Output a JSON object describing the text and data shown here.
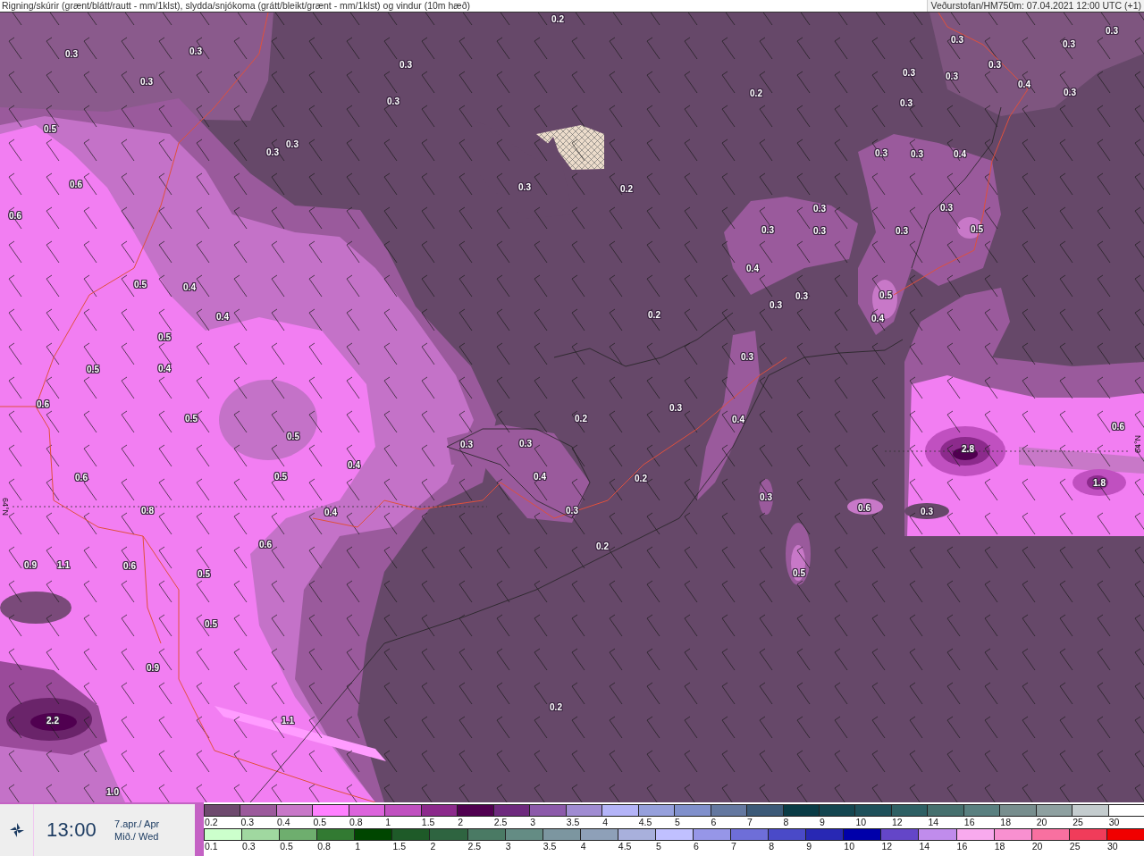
{
  "header": {
    "title": "Rigning/skúrir (grænt/blátt/rautt - mm/1klst), slydda/snjókoma (grátt/bleikt/grænt - mm/1klst) og vindur (10m hæð)",
    "source": "Veðurstofan/HM750m: 07.04.2021 12:00 UTC (+1)"
  },
  "map": {
    "labels": [
      {
        "text": "0.2"
      },
      {
        "text": "0.3"
      },
      {
        "text": "0.3"
      },
      {
        "text": "0.3"
      },
      {
        "text": "0.3"
      },
      {
        "text": "0.3"
      },
      {
        "text": "0.3"
      },
      {
        "text": "0.3"
      },
      {
        "text": "0.3"
      },
      {
        "text": "0.3"
      },
      {
        "text": "0.3"
      },
      {
        "text": "0.4"
      },
      {
        "text": "0.2"
      },
      {
        "text": "0.3"
      },
      {
        "text": "0.3"
      },
      {
        "text": "0.3"
      },
      {
        "text": "0.5"
      },
      {
        "text": "0.3"
      },
      {
        "text": "0.3"
      },
      {
        "text": "0.3"
      },
      {
        "text": "0.3"
      },
      {
        "text": "0.4"
      },
      {
        "text": "0.6"
      },
      {
        "text": "0.3"
      },
      {
        "text": "0.2"
      },
      {
        "text": "0.3"
      },
      {
        "text": "0.3"
      },
      {
        "text": "0.6"
      },
      {
        "text": "0.3"
      },
      {
        "text": "0.3"
      },
      {
        "text": "0.3"
      },
      {
        "text": "0.5"
      },
      {
        "text": "0.4"
      },
      {
        "text": "0.5"
      },
      {
        "text": "0.4"
      },
      {
        "text": "0.3"
      },
      {
        "text": "0.5"
      },
      {
        "text": "0.3"
      },
      {
        "text": "0.4"
      },
      {
        "text": "0.2"
      },
      {
        "text": "0.4"
      },
      {
        "text": "0.5"
      },
      {
        "text": "0.3"
      },
      {
        "text": "0.5"
      },
      {
        "text": "0.4"
      },
      {
        "text": "0.6"
      },
      {
        "text": "0.3"
      },
      {
        "text": "0.5"
      },
      {
        "text": "0.2"
      },
      {
        "text": "0.4"
      },
      {
        "text": "0.6"
      },
      {
        "text": "0.5"
      },
      {
        "text": "0.3"
      },
      {
        "text": "0.3"
      },
      {
        "text": "2.8"
      },
      {
        "text": "0.4"
      },
      {
        "text": "0.6"
      },
      {
        "text": "0.5"
      },
      {
        "text": "0.4"
      },
      {
        "text": "0.2"
      },
      {
        "text": "1.8"
      },
      {
        "text": "0.3"
      },
      {
        "text": "0.8"
      },
      {
        "text": "0.4"
      },
      {
        "text": "0.3"
      },
      {
        "text": "0.6"
      },
      {
        "text": "0.3"
      },
      {
        "text": "0.6"
      },
      {
        "text": "0.2"
      },
      {
        "text": "0.9"
      },
      {
        "text": "1.1"
      },
      {
        "text": "0.6"
      },
      {
        "text": "0.5"
      },
      {
        "text": "0.5"
      },
      {
        "text": "0.5"
      },
      {
        "text": "0.9"
      },
      {
        "text": "0.2"
      },
      {
        "text": "2.2"
      },
      {
        "text": "1.1"
      },
      {
        "text": "1.0"
      }
    ],
    "latitude_labels": [
      "64°N",
      "64°N"
    ]
  },
  "time_panel": {
    "time": "13:00",
    "date": "7.apr./ Apr",
    "weekday": "Mið./ Wed"
  },
  "legend": {
    "rows": [
      {
        "items": [
          {
            "label": "0.2",
            "color": "#6e4a6e"
          },
          {
            "label": "0.3",
            "color": "#9c5a9c"
          },
          {
            "label": "0.4",
            "color": "#c878c8"
          },
          {
            "label": "0.5",
            "color": "#ff80ff"
          },
          {
            "label": "0.8",
            "color": "#dc64dc"
          },
          {
            "label": "1",
            "color": "#c050c0"
          },
          {
            "label": "1.5",
            "color": "#8c2a8c"
          },
          {
            "label": "2",
            "color": "#500050"
          },
          {
            "label": "2.5",
            "color": "#6e2a7e"
          },
          {
            "label": "3",
            "color": "#8c5aaa"
          },
          {
            "label": "3.5",
            "color": "#a08cd2"
          },
          {
            "label": "4",
            "color": "#b4b4f8"
          },
          {
            "label": "4.5",
            "color": "#96a0dc"
          },
          {
            "label": "5",
            "color": "#8090cc"
          },
          {
            "label": "6",
            "color": "#6478a0"
          },
          {
            "label": "7",
            "color": "#3c5a78"
          },
          {
            "label": "8",
            "color": "#0a3c46"
          },
          {
            "label": "9",
            "color": "#144650"
          },
          {
            "label": "10",
            "color": "#1e505a"
          },
          {
            "label": "12",
            "color": "#2e6064"
          },
          {
            "label": "14",
            "color": "#46706e"
          },
          {
            "label": "16",
            "color": "#5a8080"
          },
          {
            "label": "18",
            "color": "#788e8e"
          },
          {
            "label": "20",
            "color": "#8ea0a0"
          },
          {
            "label": "25",
            "color": "#c4ccce"
          },
          {
            "label": "30",
            "color": "#ffffff"
          }
        ]
      },
      {
        "items": [
          {
            "label": "0.1",
            "color": "#ccffcc"
          },
          {
            "label": "0.3",
            "color": "#a0d8a0"
          },
          {
            "label": "0.5",
            "color": "#6eae6e"
          },
          {
            "label": "0.8",
            "color": "#327a32"
          },
          {
            "label": "1",
            "color": "#004600"
          },
          {
            "label": "1.5",
            "color": "#1e5a28"
          },
          {
            "label": "2",
            "color": "#2e6440"
          },
          {
            "label": "2.5",
            "color": "#4a7a64"
          },
          {
            "label": "3",
            "color": "#648c84"
          },
          {
            "label": "3.5",
            "color": "#7c96a0"
          },
          {
            "label": "4",
            "color": "#8ea0b8"
          },
          {
            "label": "4.5",
            "color": "#a8b0dc"
          },
          {
            "label": "5",
            "color": "#c0c0ff"
          },
          {
            "label": "6",
            "color": "#9696e8"
          },
          {
            "label": "7",
            "color": "#6e6ed8"
          },
          {
            "label": "8",
            "color": "#4a4ac8"
          },
          {
            "label": "9",
            "color": "#2828b4"
          },
          {
            "label": "10",
            "color": "#0000aa"
          },
          {
            "label": "12",
            "color": "#6446c8"
          },
          {
            "label": "14",
            "color": "#c08cec"
          },
          {
            "label": "16",
            "color": "#f8aaee"
          },
          {
            "label": "18",
            "color": "#f890d0"
          },
          {
            "label": "20",
            "color": "#f870a0"
          },
          {
            "label": "25",
            "color": "#f03c5a"
          },
          {
            "label": "30",
            "color": "#f00000"
          }
        ]
      }
    ]
  }
}
